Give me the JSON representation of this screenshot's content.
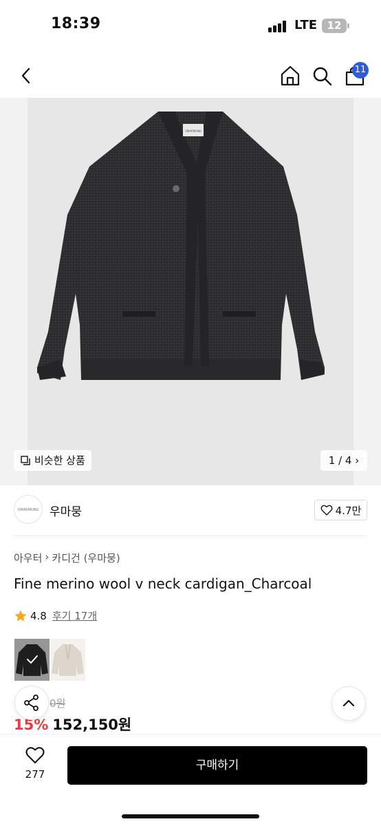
{
  "status": {
    "time": "18:39",
    "network": "LTE",
    "battery": "12"
  },
  "nav": {
    "cart_count": "11"
  },
  "image": {
    "brand_tag": "UMARMUNG",
    "similar_label": "비슷한 상품",
    "counter": "1 / 4"
  },
  "brand": {
    "logo_text": "UMARMUNG",
    "name": "우마뭉",
    "likes": "4.7만"
  },
  "breadcrumb": {
    "parent": "아우터",
    "child": "카디건 (우마뭉)"
  },
  "product": {
    "title": "Fine merino wool v neck cardigan_Charcoal",
    "rating": "4.8",
    "review_label": "후기 17개",
    "original_price": "0원",
    "discount": "15%",
    "price": "152,150원"
  },
  "colors": {
    "swatches": [
      "charcoal",
      "oatmeal"
    ],
    "selected": "charcoal"
  },
  "bottom": {
    "wish_count": "277",
    "buy_label": "구매하기"
  },
  "theme": {
    "accent": "#2e5bd9",
    "discount_color": "#f2373e",
    "star_color": "#f5a623"
  }
}
